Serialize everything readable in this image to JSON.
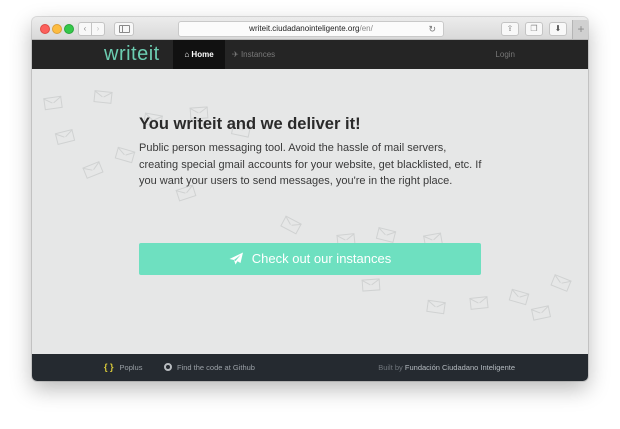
{
  "browser": {
    "url_domain": "writeit.ciudadanointeligente.org",
    "url_path": "/en/",
    "back_glyph": "‹",
    "forward_glyph": "›",
    "reload_glyph": "↻",
    "share_glyph": "⇪",
    "tabs_glyph": "❐",
    "download_glyph": "⬇",
    "newtab_glyph": "+"
  },
  "navbar": {
    "brand": "writeit",
    "home_label": "Home",
    "home_glyph": "⌂",
    "instances_label": "Instances",
    "instances_glyph": "✈",
    "login_label": "Login"
  },
  "hero": {
    "title": "You writeit and we deliver it!",
    "text": "Public person messaging tool. Avoid the hassle of mail servers, creating special gmail accounts for your website, get blacklisted, etc. If you want your users to send messages, you're in the right place.",
    "cta_label": "Check out our instances"
  },
  "footer": {
    "poplus_glyph": "{ }",
    "poplus_label": "Poplus",
    "github_label": "Find the code at Github",
    "built_prefix": "Built by",
    "built_org": "Fundación Ciudadano Inteligente"
  },
  "colors": {
    "brand": "#6ccdb1",
    "cta": "#6ee0c0",
    "navbar": "#252525",
    "footer": "#252a30",
    "hero_bg": "#e6e7e7"
  }
}
